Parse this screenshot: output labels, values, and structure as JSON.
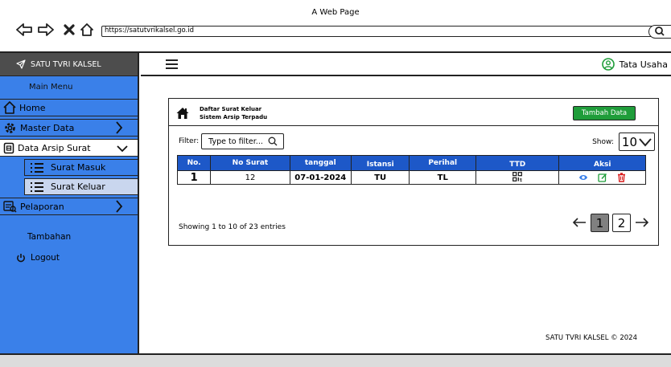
{
  "browser": {
    "title": "A Web Page",
    "url": "https://satutvrikalsel.go.id",
    "back_icon": "arrow-left-outline-icon",
    "forward_icon": "arrow-right-outline-icon",
    "stop_icon": "close-icon",
    "home_icon": "home-outline-icon"
  },
  "sidebar": {
    "brand": "SATU TVRI KALSEL",
    "section_main": "Main Menu",
    "home": "Home",
    "master_data": "Master Data",
    "data_arsip": "Data Arsip Surat",
    "surat_masuk": "Surat Masuk",
    "surat_keluar": "Surat Keluar",
    "pelaporan": "Pelaporan",
    "section_extra": "Tambahan",
    "logout": "Logout"
  },
  "topbar": {
    "user_name": "Tata Usaha"
  },
  "card": {
    "title_line1": "Daftar Surat Keluar",
    "title_line2": "Sistem Arsip Terpadu",
    "add_button": "Tambah Data",
    "filter_label": "Filter:",
    "filter_placeholder": "Type to filter...",
    "show_label": "Show:",
    "show_value": "10",
    "columns": [
      "No.",
      "No Surat",
      "tanggal",
      "Istansi",
      "Perihal",
      "TTD",
      "Aksi"
    ],
    "rows": [
      {
        "no": "1",
        "no_surat": "12",
        "tanggal": "07-01-2024",
        "instansi": "TU",
        "perihal": "TL"
      }
    ],
    "showing": "Showing 1 to 10 of 23 entries",
    "pages": [
      "1",
      "2"
    ],
    "active_page": "1"
  },
  "footer": {
    "text": "SATU TVRI KALSEL © 2024"
  },
  "colors": {
    "sidebar_bg": "#3a80e9",
    "brand_bg": "#4d4d4d",
    "table_header": "#1d58c8",
    "add_button": "#1f9d3a",
    "user_icon": "#1f9d3a"
  }
}
